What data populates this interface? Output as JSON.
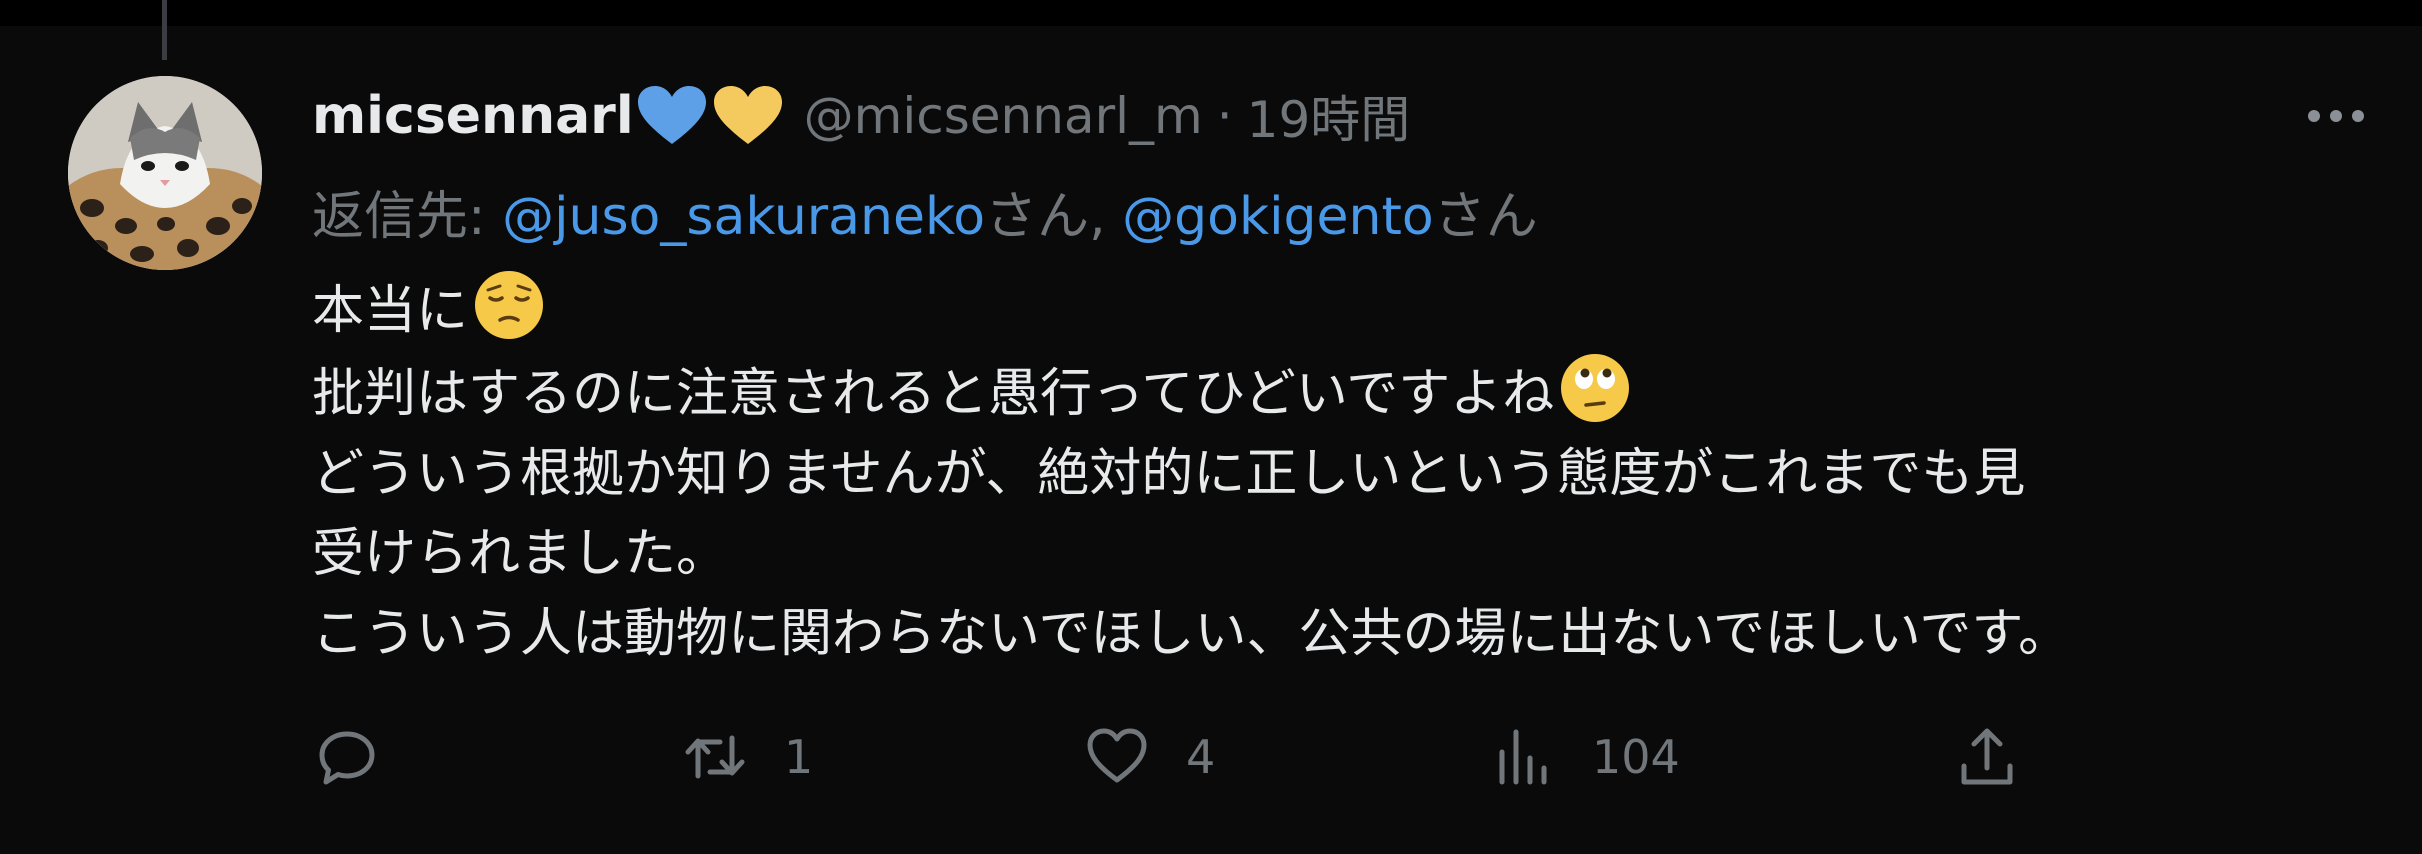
{
  "tweet": {
    "display_name": "micsennarl",
    "name_emojis": [
      "blue-heart-icon",
      "yellow-heart-icon"
    ],
    "handle": "@micsennarl_m",
    "separator": "·",
    "time": "19時間",
    "reply_to": {
      "prefix": "返信先: ",
      "mentions": [
        {
          "handle": "@juso_sakuraneko",
          "suffix": "さん, "
        },
        {
          "handle": "@gokigento",
          "suffix": "さん"
        }
      ]
    },
    "body_lines": [
      {
        "text": "本当に",
        "emoji": "pensive-face-icon"
      },
      {
        "text": "批判はするのに注意されると愚行ってひどいですよね",
        "emoji": "eye-roll-face-icon"
      },
      {
        "text": "どういう根拠か知りませんが、絶対的に正しいという態度がこれまでも見"
      },
      {
        "text": "受けられました。"
      },
      {
        "text": "こういう人は動物に関わらないでほしい、公共の場に出ないでほしいです。"
      }
    ],
    "actions": {
      "reply": {
        "count": ""
      },
      "retweet": {
        "count": "1"
      },
      "like": {
        "count": "4"
      },
      "views": {
        "count": "104"
      },
      "share": {}
    }
  },
  "colors": {
    "background": "#0a0a0a",
    "text": "#e7e9ea",
    "secondary": "#71767b",
    "link": "#4a99e9",
    "blue_heart": "#5da0e8",
    "yellow_heart": "#f4c95d"
  }
}
